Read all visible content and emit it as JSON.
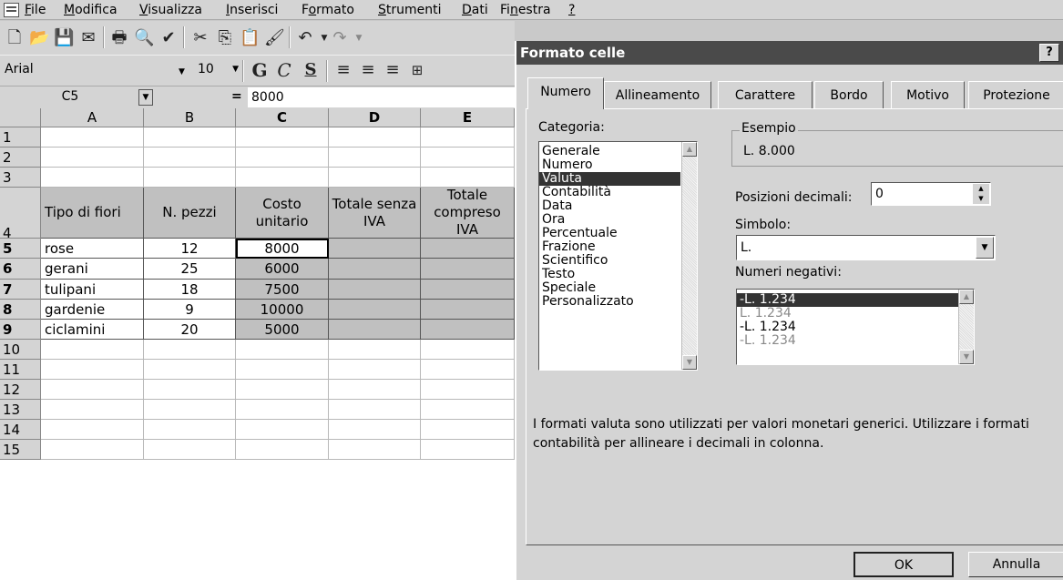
{
  "menu": {
    "items": [
      "File",
      "Modifica",
      "Visualizza",
      "Inserisci",
      "Formato",
      "Strumenti",
      "Dati",
      "Finestra",
      "?"
    ],
    "underline": [
      "F",
      "M",
      "V",
      "I",
      "o",
      "S",
      "D",
      "n",
      "?"
    ]
  },
  "toolbar2": {
    "font": "Arial",
    "size": "10",
    "bold": "G",
    "italic": "C",
    "underline": "S"
  },
  "formula": {
    "namebox": "C5",
    "equals": "=",
    "value": "8000"
  },
  "grid": {
    "columns": [
      "A",
      "B",
      "C",
      "D",
      "E"
    ],
    "rows": [
      "1",
      "2",
      "3",
      "4",
      "5",
      "6",
      "7",
      "8",
      "9",
      "10",
      "11",
      "12",
      "13",
      "14",
      "15"
    ],
    "headers": [
      "Tipo di fiori",
      "N. pezzi",
      "Costo unitario",
      "Totale senza IVA",
      "Totale compreso IVA"
    ],
    "data": [
      [
        "rose",
        "12",
        "8000"
      ],
      [
        "gerani",
        "25",
        "6000"
      ],
      [
        "tulipani",
        "18",
        "7500"
      ],
      [
        "gardenie",
        "9",
        "10000"
      ],
      [
        "ciclamini",
        "20",
        "5000"
      ]
    ]
  },
  "dialog": {
    "title": "Formato celle",
    "help": "?",
    "tabs": [
      "Numero",
      "Allineamento",
      "Carattere",
      "Bordo",
      "Motivo",
      "Protezione"
    ],
    "categoria_label": "Categoria:",
    "categorie": [
      "Generale",
      "Numero",
      "Valuta",
      "Contabilità",
      "Data",
      "Ora",
      "Percentuale",
      "Frazione",
      "Scientifico",
      "Testo",
      "Speciale",
      "Personalizzato"
    ],
    "selected_categoria": "Valuta",
    "esempio_label": "Esempio",
    "esempio_value": "L. 8.000",
    "decimali_label": "Posizioni decimali:",
    "decimali_value": "0",
    "simbolo_label": "Simbolo:",
    "simbolo_value": "L.",
    "negativi_label": "Numeri negativi:",
    "negativi": [
      "-L. 1.234",
      "L. 1.234",
      "-L. 1.234",
      "-L. 1.234"
    ],
    "description": "I formati valuta sono utilizzati per valori  monetari generici. Utilizzare i formati contabilità per allineare i decimali in colonna.",
    "ok": "OK",
    "annulla": "Annulla"
  }
}
